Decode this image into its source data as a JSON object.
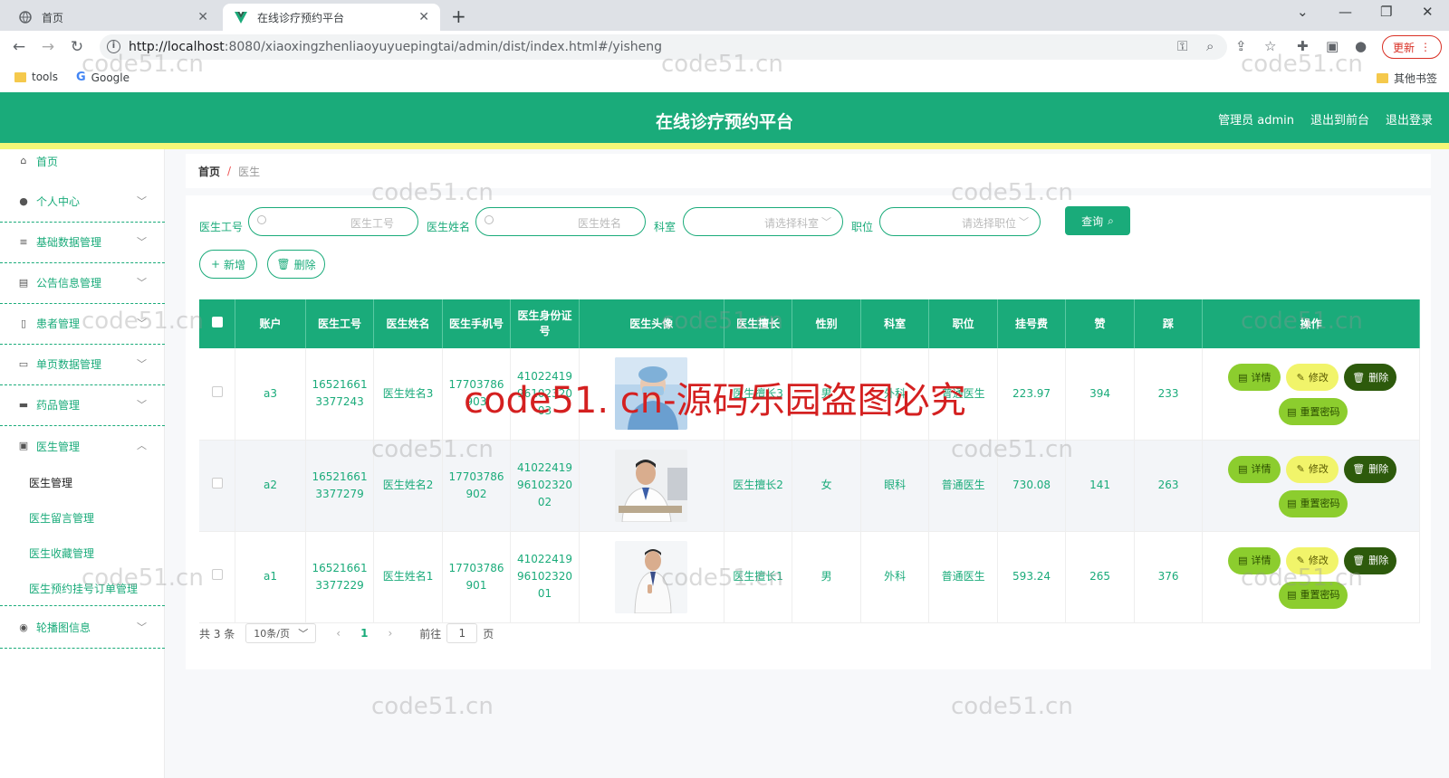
{
  "browser": {
    "tabs": [
      {
        "title": "首页",
        "icon": "globe-icon"
      },
      {
        "title": "在线诊疗预约平台",
        "icon": "vue-logo-icon"
      }
    ],
    "url_host": "http://localhost",
    "url_rest": ":8080/xiaoxingzhenliaoyuyuepingtai/admin/dist/index.html#/yisheng",
    "update_label": "更新",
    "bookmarks": [
      {
        "label": "tools",
        "icon": "folder-icon"
      },
      {
        "label": "Google",
        "icon": "google-icon"
      }
    ],
    "other_bookmarks": "其他书签"
  },
  "header": {
    "title": "在线诊疗预约平台",
    "links": [
      "管理员 admin",
      "退出到前台",
      "退出登录"
    ]
  },
  "sidebar": {
    "items": [
      {
        "label": "首页",
        "icon": "home-icon",
        "expandable": false
      },
      {
        "label": "个人中心",
        "icon": "user-icon",
        "expandable": true
      },
      {
        "label": "基础数据管理",
        "icon": "sliders-icon",
        "expandable": true
      },
      {
        "label": "公告信息管理",
        "icon": "notice-icon",
        "expandable": true
      },
      {
        "label": "患者管理",
        "icon": "patient-icon",
        "expandable": true
      },
      {
        "label": "单页数据管理",
        "icon": "page-icon",
        "expandable": true
      },
      {
        "label": "药品管理",
        "icon": "pill-icon",
        "expandable": true
      },
      {
        "label": "医生管理",
        "icon": "doctor-icon",
        "expandable": true,
        "open": true
      },
      {
        "label": "轮播图信息",
        "icon": "carousel-icon",
        "expandable": true
      }
    ],
    "doctor_submenu": [
      "医生管理",
      "医生留言管理",
      "医生收藏管理",
      "医生预约挂号订单管理"
    ]
  },
  "breadcrumb": {
    "home": "首页",
    "sep": "/",
    "current": "医生"
  },
  "filters": {
    "doctor_no_label": "医生工号",
    "doctor_no_placeholder": "医生工号",
    "doctor_name_label": "医生姓名",
    "doctor_name_placeholder": "医生姓名",
    "dept_label": "科室",
    "dept_placeholder": "请选择科室",
    "title_label": "职位",
    "title_placeholder": "请选择职位",
    "search_label": "查询"
  },
  "actions": {
    "add_label": "新增",
    "delete_label": "删除"
  },
  "table": {
    "headers": [
      "账户",
      "医生工号",
      "医生姓名",
      "医生手机号",
      "医生身份证号",
      "医生头像",
      "医生擅长",
      "性别",
      "科室",
      "职位",
      "挂号费",
      "赞",
      "踩",
      "操作"
    ],
    "rows": [
      {
        "account": "a3",
        "doctor_no": "165216613377243",
        "name": "医生姓名3",
        "phone": "17703786903",
        "id_card": "410224199610232003",
        "specialty": "医生擅长3",
        "gender": "男",
        "dept": "外科",
        "position": "普通医生",
        "fee": "223.97",
        "likes": "394",
        "dislikes": "233"
      },
      {
        "account": "a2",
        "doctor_no": "165216613377279",
        "name": "医生姓名2",
        "phone": "17703786902",
        "id_card": "410224199610232002",
        "specialty": "医生擅长2",
        "gender": "女",
        "dept": "眼科",
        "position": "普通医生",
        "fee": "730.08",
        "likes": "141",
        "dislikes": "263"
      },
      {
        "account": "a1",
        "doctor_no": "165216613377229",
        "name": "医生姓名1",
        "phone": "17703786901",
        "id_card": "410224199610232001",
        "specialty": "医生擅长1",
        "gender": "男",
        "dept": "外科",
        "position": "普通医生",
        "fee": "593.24",
        "likes": "265",
        "dislikes": "376"
      }
    ],
    "op_labels": {
      "detail": "详情",
      "edit": "修改",
      "delete": "删除",
      "reset_pwd": "重置密码"
    }
  },
  "pager": {
    "total": "共 3 条",
    "page_size": "10条/页",
    "current": "1",
    "goto_label": "前往",
    "goto_value": "1",
    "page_suffix": "页"
  },
  "watermark": {
    "small": "code51.cn",
    "big": "code51. cn-源码乐园盗图必究"
  },
  "colors": {
    "primary": "#1aab7a",
    "accent_yellow": "#f3f777",
    "detail_btn": "#8ccd2e",
    "edit_btn": "#f1f46a",
    "delete_btn": "#2d5a0c"
  }
}
